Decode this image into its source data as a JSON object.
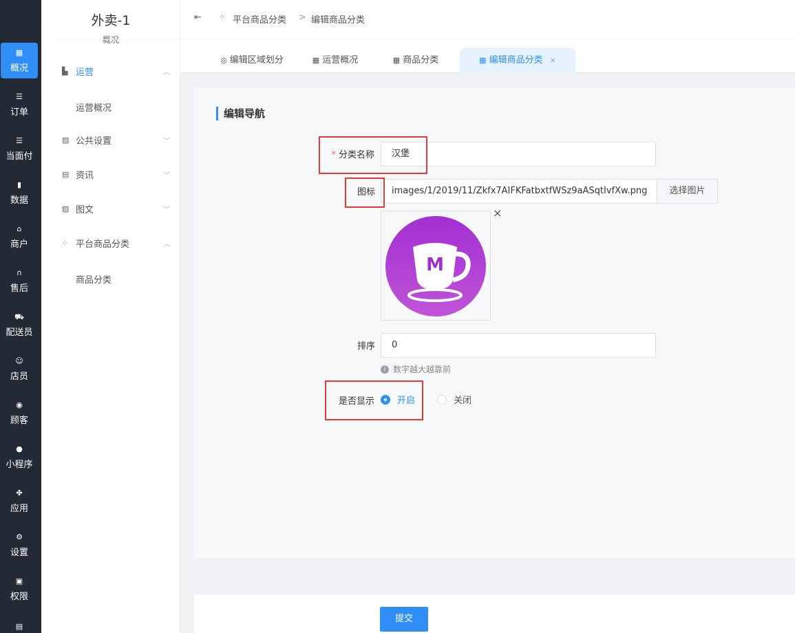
{
  "rail": {
    "items": [
      {
        "label": "概况",
        "icon": "grid-icon"
      },
      {
        "label": "订单",
        "icon": "list-icon"
      },
      {
        "label": "当面付",
        "icon": "list-icon"
      },
      {
        "label": "数据",
        "icon": "bar-chart-icon"
      },
      {
        "label": "商户",
        "icon": "store-icon"
      },
      {
        "label": "售后",
        "icon": "headphones-icon"
      },
      {
        "label": "配送员",
        "icon": "delivery-icon"
      },
      {
        "label": "店员",
        "icon": "users-icon"
      },
      {
        "label": "顾客",
        "icon": "user-circle-icon"
      },
      {
        "label": "小程序",
        "icon": "wechat-icon"
      },
      {
        "label": "应用",
        "icon": "apps-icon"
      },
      {
        "label": "设置",
        "icon": "settings-icon"
      },
      {
        "label": "权限",
        "icon": "lock-icon"
      }
    ]
  },
  "sidebar": {
    "shop_name": "外卖-1",
    "shop_sub": "概况",
    "groups": [
      {
        "label": "运营",
        "icon": "operations-icon",
        "expanded": true
      },
      {
        "label": "公共设置",
        "icon": "image-icon",
        "expanded": false
      },
      {
        "label": "资讯",
        "icon": "document-icon",
        "expanded": false
      },
      {
        "label": "图文",
        "icon": "picture-icon",
        "expanded": false
      },
      {
        "label": "平台商品分类",
        "icon": "category-icon",
        "expanded": true
      }
    ],
    "sub_items": [
      "运营概况",
      "商品分类"
    ]
  },
  "breadcrumb": {
    "collapse_icon": "menu-collapse-icon",
    "parent": "平台商品分类",
    "separator": ">",
    "current": "编辑商品分类"
  },
  "tabs": [
    {
      "label": "编辑区域划分",
      "icon": "user-circle-icon"
    },
    {
      "label": "运营概况",
      "icon": "grid-icon"
    },
    {
      "label": "商品分类",
      "icon": "grid-icon"
    },
    {
      "label": "编辑商品分类",
      "icon": "grid-icon",
      "active": true,
      "close": "×"
    }
  ],
  "form": {
    "section_title": "编辑导航",
    "required_mark": "*",
    "name_label": "分类名称",
    "name_value": "汉堡",
    "icon_label": "图标",
    "icon_path": "images/1/2019/11/Zkfx7AIFKFatbxtfWSz9aASqtIvfXw.png",
    "pick_image": "选择图片",
    "remove_image": "×",
    "sort_label": "排序",
    "sort_value": "0",
    "sort_hint": "数字越大越靠前",
    "display_label": "是否显示",
    "display_on": "开启",
    "display_off": "关闭",
    "display_value": "开启",
    "logo_letter": "M"
  },
  "footer": {
    "submit": "提交"
  },
  "colors": {
    "accent": "#2f8ff7",
    "rail_bg": "#232a36",
    "highlight": "#e53935",
    "logo_purple": "#a832c9"
  }
}
